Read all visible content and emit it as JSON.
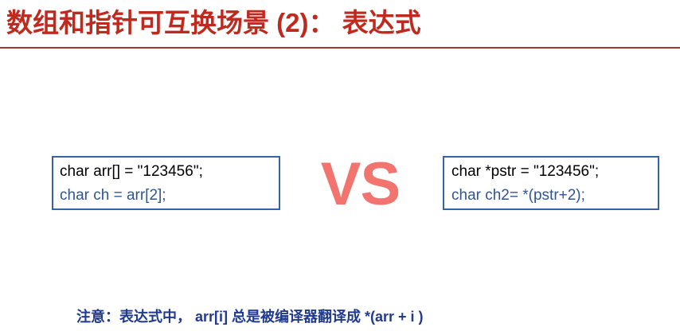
{
  "slide": {
    "title": "数组和指针可互换场景 (2)： 表达式",
    "left_code": {
      "line1": "char arr[] = \"123456\";",
      "line2": "char ch = arr[2];"
    },
    "vs": "VS",
    "right_code": {
      "line1": "char *pstr = \"123456\";",
      "line2": "char ch2= *(pstr+2);"
    },
    "note": "注意：表达式中， arr[i] 总是被编译器翻译成 *(arr + i )"
  },
  "colors": {
    "title": "#BF2A1F",
    "divider": "#A0382B",
    "box_border": "#3464A8",
    "code_primary": "#000000",
    "code_highlight": "#2F5597",
    "vs": "#F2746E",
    "note": "#203A8C"
  }
}
